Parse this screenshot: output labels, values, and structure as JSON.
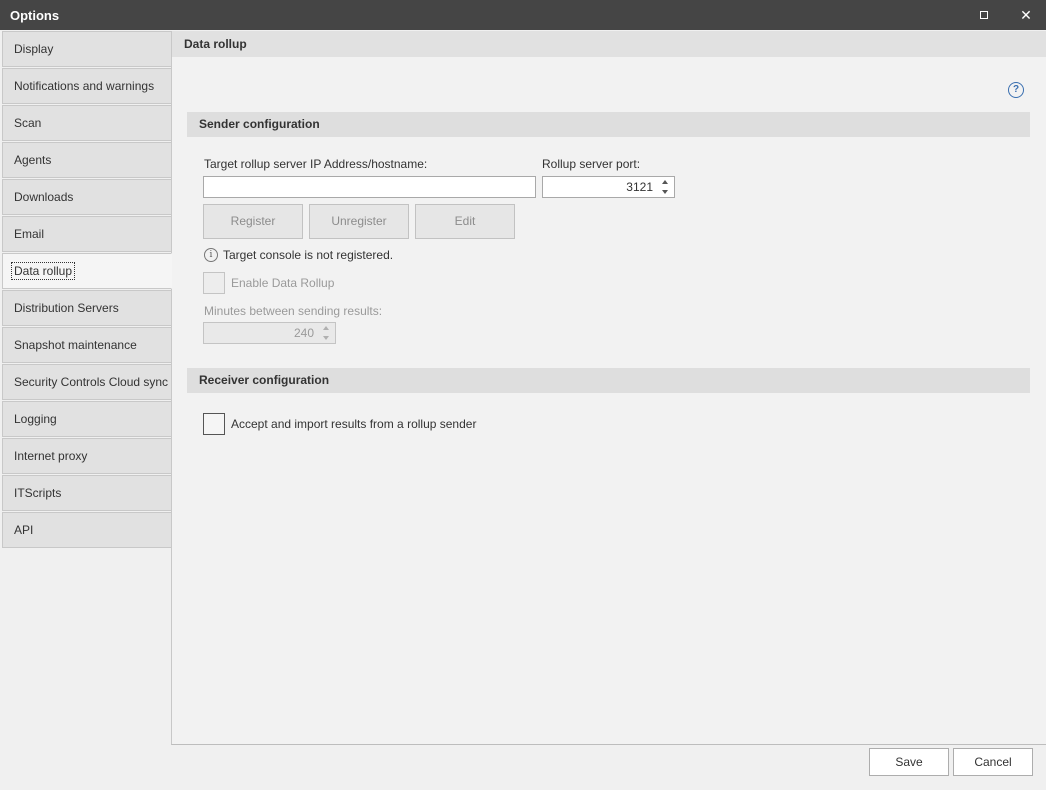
{
  "window": {
    "title": "Options",
    "maximize_icon": "maximize-icon",
    "close_glyph": "✕"
  },
  "sidebar": {
    "items": [
      {
        "label": "Display"
      },
      {
        "label": "Notifications and warnings"
      },
      {
        "label": "Scan"
      },
      {
        "label": "Agents"
      },
      {
        "label": "Downloads"
      },
      {
        "label": "Email"
      },
      {
        "label": "Data rollup",
        "active": true
      },
      {
        "label": "Distribution Servers"
      },
      {
        "label": "Snapshot maintenance"
      },
      {
        "label": "Security Controls Cloud sync"
      },
      {
        "label": "Logging"
      },
      {
        "label": "Internet proxy"
      },
      {
        "label": "ITScripts"
      },
      {
        "label": "API"
      }
    ]
  },
  "main": {
    "title": "Data rollup",
    "help_glyph": "?",
    "sender": {
      "heading": "Sender configuration",
      "target_label": "Target rollup server IP Address/hostname:",
      "target_value": "",
      "port_label": "Rollup server port:",
      "port_value": "3121",
      "buttons": {
        "register": "Register",
        "unregister": "Unregister",
        "edit": "Edit"
      },
      "info_glyph": "i",
      "status_text": "Target console is not registered.",
      "enable_label": "Enable Data Rollup",
      "minutes_label": "Minutes between sending results:",
      "minutes_value": "240"
    },
    "receiver": {
      "heading": "Receiver configuration",
      "accept_label": "Accept and import results from a rollup sender"
    }
  },
  "footer": {
    "save_label": "Save",
    "cancel_label": "Cancel"
  }
}
